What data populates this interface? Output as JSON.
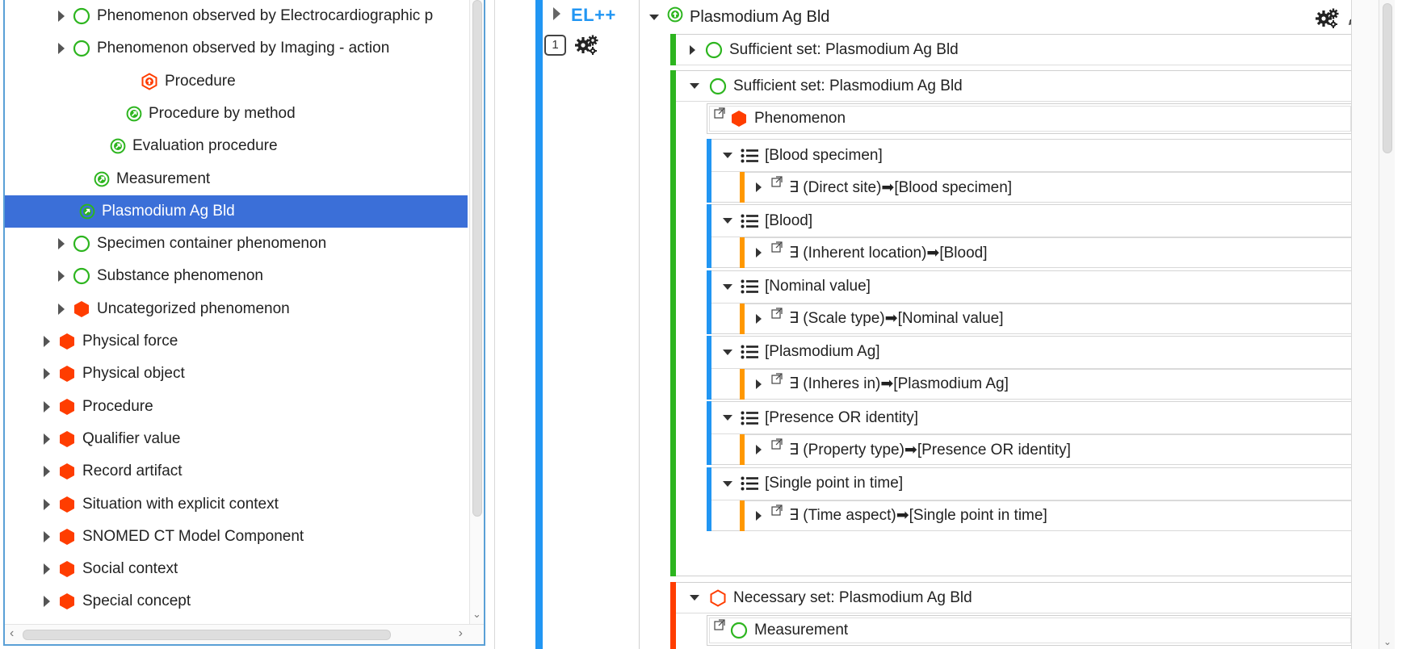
{
  "left_tree": {
    "items": [
      {
        "label": "Phenomenon observed by Electrocardiographic p",
        "icon": "circle-green-outline",
        "expander": true,
        "indent": 70
      },
      {
        "label": "Phenomenon observed by Imaging - action",
        "icon": "circle-green-outline",
        "expander": true,
        "indent": 70
      },
      {
        "label": "Procedure",
        "icon": "hex-orange-arrow-up",
        "expander": false,
        "indent": 154
      },
      {
        "label": "Procedure by method",
        "icon": "circle-green-arrow",
        "expander": false,
        "indent": 136
      },
      {
        "label": "Evaluation procedure",
        "icon": "circle-green-arrow",
        "expander": false,
        "indent": 116
      },
      {
        "label": "Measurement",
        "icon": "circle-green-arrow",
        "expander": false,
        "indent": 96
      },
      {
        "label": "Plasmodium Ag Bld",
        "icon": "circle-green-arrow",
        "expander": false,
        "indent": 78,
        "selected": true
      },
      {
        "label": "Specimen container phenomenon",
        "icon": "circle-green-outline",
        "expander": true,
        "indent": 70
      },
      {
        "label": "Substance phenomenon",
        "icon": "circle-green-outline",
        "expander": true,
        "indent": 70
      },
      {
        "label": "Uncategorized phenomenon",
        "icon": "hex-red",
        "expander": true,
        "indent": 70
      },
      {
        "label": "Physical force",
        "icon": "hex-red",
        "expander": true,
        "indent": 52
      },
      {
        "label": "Physical object",
        "icon": "hex-red",
        "expander": true,
        "indent": 52
      },
      {
        "label": "Procedure",
        "icon": "hex-red",
        "expander": true,
        "indent": 52
      },
      {
        "label": "Qualifier value",
        "icon": "hex-red",
        "expander": true,
        "indent": 52
      },
      {
        "label": "Record artifact",
        "icon": "hex-red",
        "expander": true,
        "indent": 52
      },
      {
        "label": "Situation with explicit context",
        "icon": "hex-red",
        "expander": true,
        "indent": 52
      },
      {
        "label": "SNOMED CT Model Component",
        "icon": "hex-red",
        "expander": true,
        "indent": 52
      },
      {
        "label": "Social context",
        "icon": "hex-red",
        "expander": true,
        "indent": 52
      },
      {
        "label": "Special concept",
        "icon": "hex-red",
        "expander": true,
        "indent": 52
      }
    ]
  },
  "right": {
    "el_label": "EL++",
    "count_badge": "1",
    "concept_title": "Plasmodium Ag Bld",
    "sufficient_set_collapsed": "Sufficient set: Plasmodium Ag Bld",
    "sufficient_set_expanded": "Sufficient set: Plasmodium Ag Bld",
    "parent_concept": "Phenomenon",
    "groups": [
      {
        "title": "[Blood specimen]",
        "relation": "∃ (Direct site)➡[Blood specimen]"
      },
      {
        "title": "[Blood]",
        "relation": "∃ (Inherent location)➡[Blood]"
      },
      {
        "title": "[Nominal value]",
        "relation": "∃ (Scale type)➡[Nominal value]"
      },
      {
        "title": "[Plasmodium Ag]",
        "relation": "∃ (Inheres in)➡[Plasmodium Ag]"
      },
      {
        "title": "[Presence OR identity]",
        "relation": "∃ (Property type)➡[Presence OR identity]"
      },
      {
        "title": "[Single point in time]",
        "relation": "∃ (Time aspect)➡[Single point in time]"
      }
    ],
    "necessary_set": "Necessary set: Plasmodium Ag Bld",
    "necessary_parent": "Measurement"
  },
  "colors": {
    "selection": "#3b6fd8",
    "green": "#2db51f",
    "red": "#ff3d00",
    "blue": "#2196f3",
    "orange": "#ff9800"
  }
}
